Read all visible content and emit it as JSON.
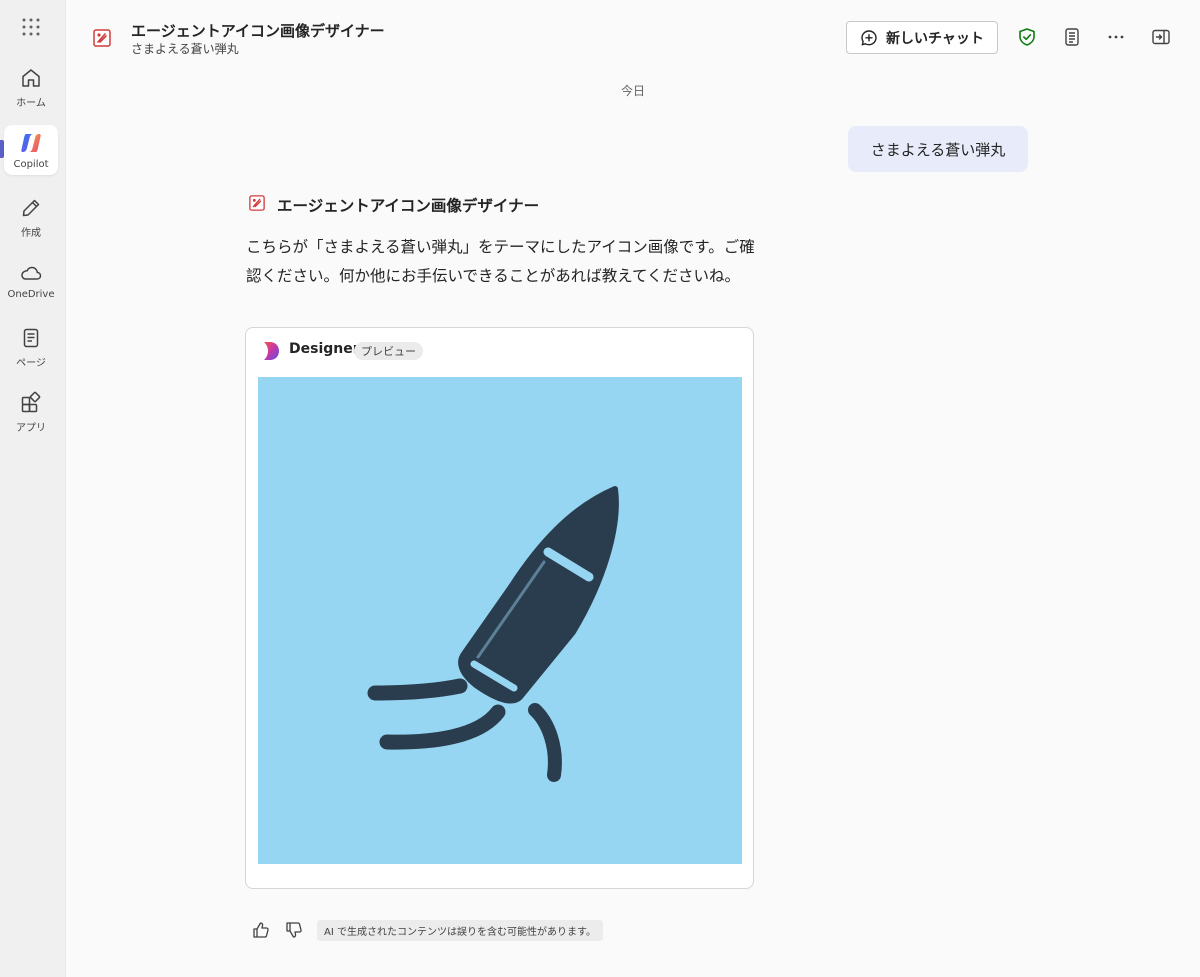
{
  "rail": {
    "items": [
      {
        "label": "ホーム",
        "icon": "home-icon"
      },
      {
        "label": "Copilot",
        "icon": "copilot-icon"
      },
      {
        "label": "作成",
        "icon": "pen-icon"
      },
      {
        "label": "OneDrive",
        "icon": "cloud-icon"
      },
      {
        "label": "ページ",
        "icon": "page-icon"
      },
      {
        "label": "アプリ",
        "icon": "apps-icon"
      }
    ],
    "active": "Copilot",
    "accent": "#5b5fc7"
  },
  "header": {
    "title": "エージェントアイコン画像デザイナー",
    "subtitle": "さまよえる蒼い弾丸",
    "new_chat_label": "新しいチャット"
  },
  "chat": {
    "date_separator": "今日",
    "user_message": "さまよえる蒼い弾丸",
    "agent_name": "エージェントアイコン画像デザイナー",
    "agent_message": "こちらが「さまよえる蒼い弾丸」をテーマにしたアイコン画像です。ご確認ください。何か他にお手伝いできることがあれば教えてくださいね。",
    "card": {
      "app_name": "Designer",
      "badge": "プレビュー",
      "image_bg": "#97d6f2",
      "image_fg": "#2a3d4e"
    },
    "disclaimer": "AI で生成されたコンテンツは誤りを含む可能性があります。"
  }
}
